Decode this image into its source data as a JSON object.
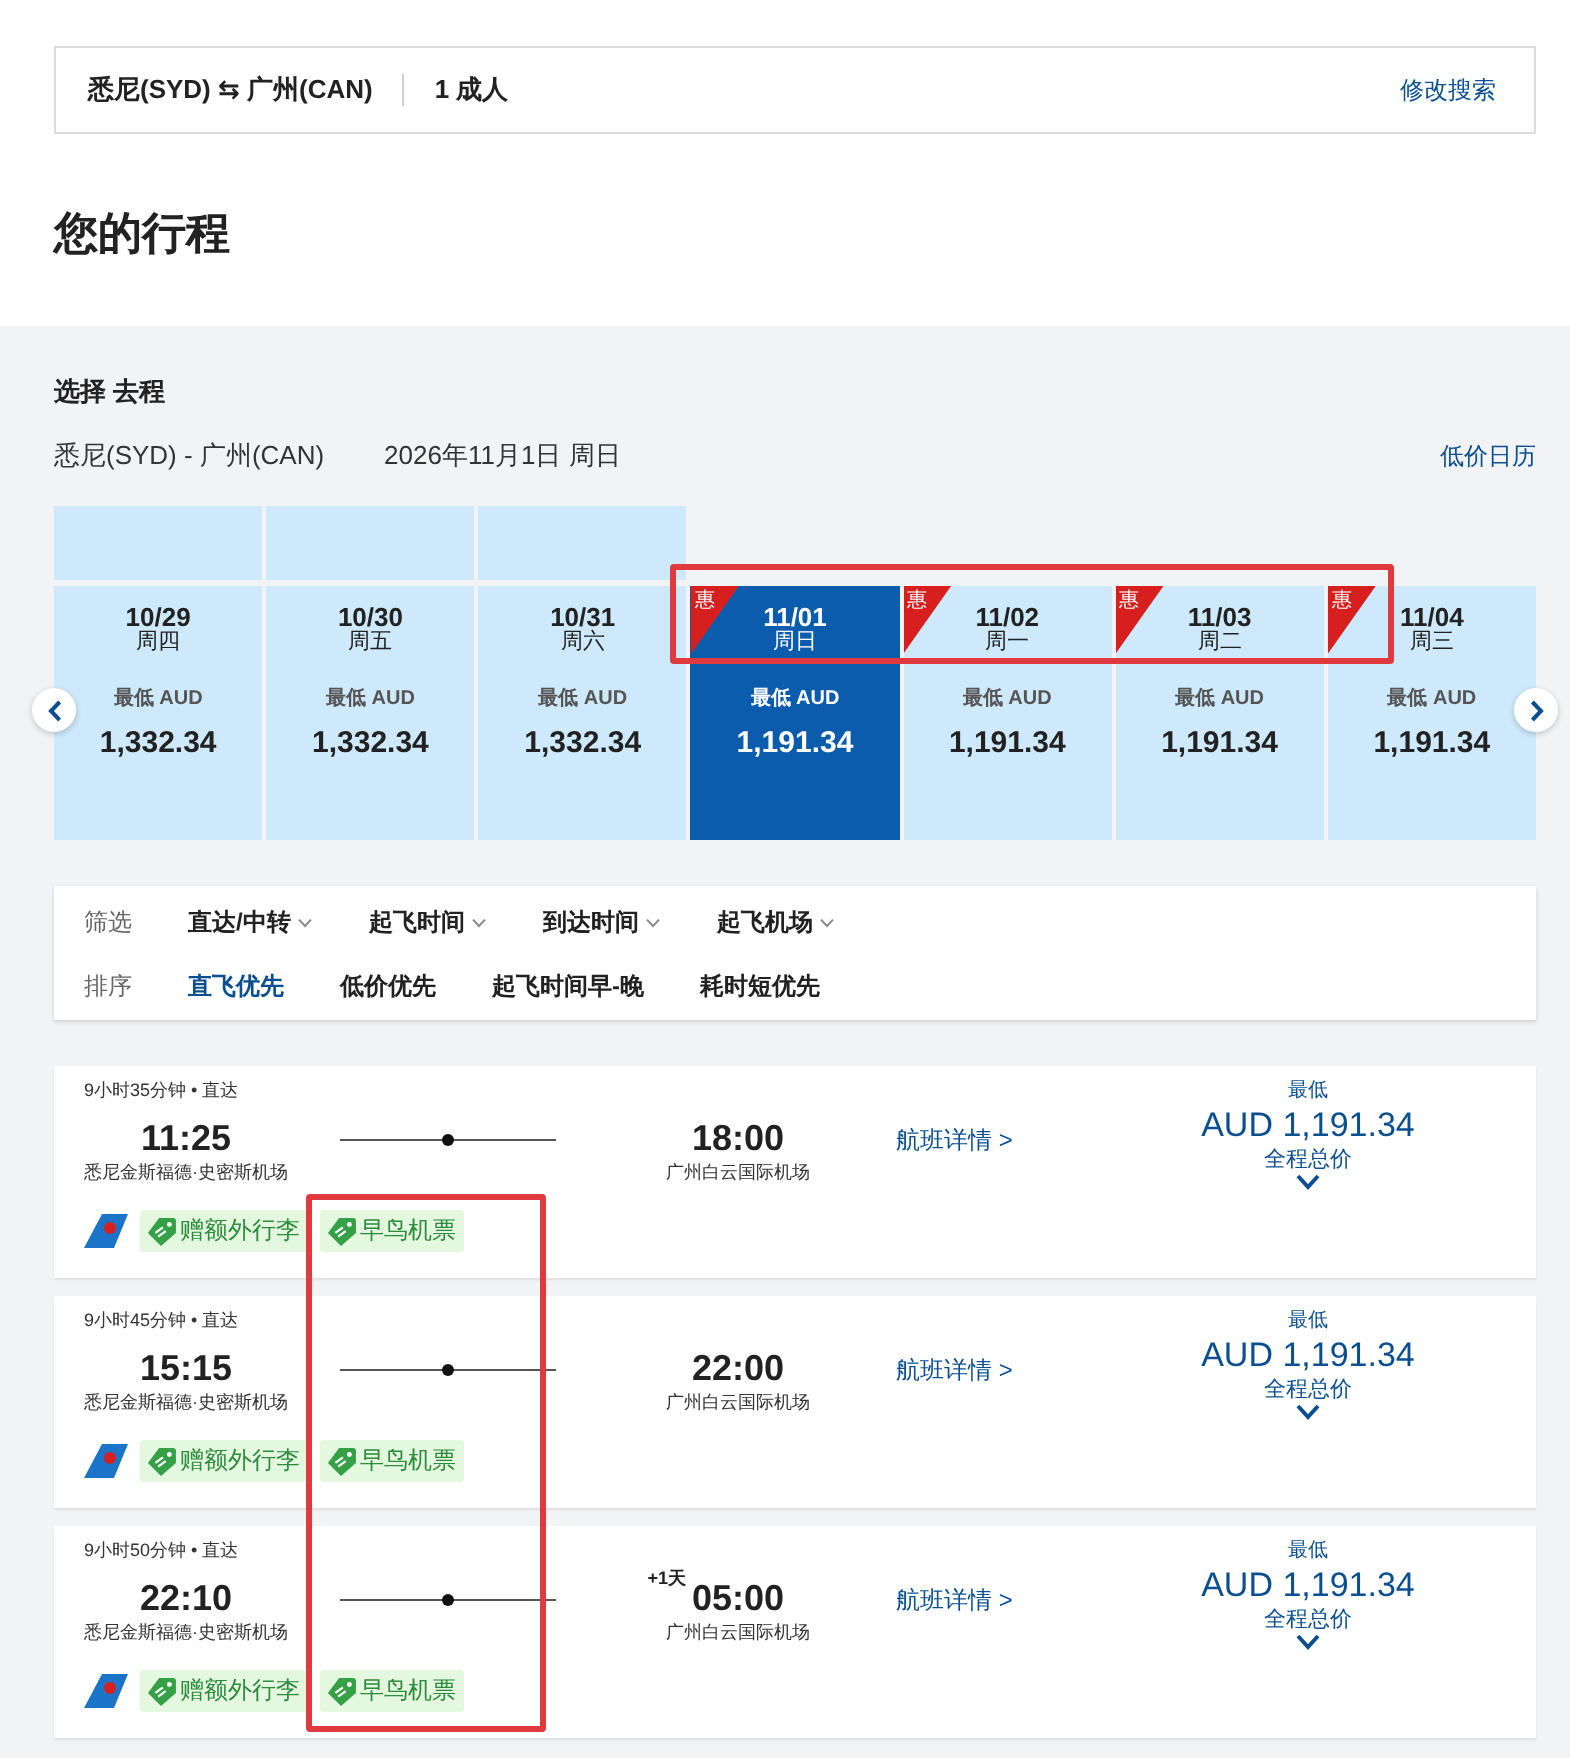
{
  "search_summary": {
    "route": "悉尼(SYD) ⇆ 广州(CAN)",
    "passengers": "1 成人",
    "modify_link": "修改搜索"
  },
  "page_title": "您的行程",
  "section": {
    "title": "选择 去程",
    "route": "悉尼(SYD) - 广州(CAN)",
    "date": "2026年11月1日 周日",
    "calendar_link": "低价日历"
  },
  "date_strip": {
    "highlighted": true,
    "dates": [
      {
        "date": "10/29",
        "weekday": "周四",
        "price_label": "最低 AUD",
        "price": "1,332.34",
        "selected": false,
        "top_block": true
      },
      {
        "date": "10/30",
        "weekday": "周五",
        "price_label": "最低 AUD",
        "price": "1,332.34",
        "selected": false,
        "top_block": true
      },
      {
        "date": "10/31",
        "weekday": "周六",
        "price_label": "最低 AUD",
        "price": "1,332.34",
        "selected": false,
        "top_block": true
      },
      {
        "date": "11/01",
        "weekday": "周日",
        "price_label": "最低 AUD",
        "price": "1,191.34",
        "selected": true,
        "top_block": false,
        "badge": "惠"
      },
      {
        "date": "11/02",
        "weekday": "周一",
        "price_label": "最低 AUD",
        "price": "1,191.34",
        "selected": false,
        "top_block": false,
        "badge": "惠"
      },
      {
        "date": "11/03",
        "weekday": "周二",
        "price_label": "最低 AUD",
        "price": "1,191.34",
        "selected": false,
        "top_block": false,
        "badge": "惠"
      },
      {
        "date": "11/04",
        "weekday": "周三",
        "price_label": "最低 AUD",
        "price": "1,191.34",
        "selected": false,
        "top_block": false,
        "badge": "惠"
      }
    ]
  },
  "filters": {
    "label": "筛选",
    "items": [
      "直达/中转",
      "起飞时间",
      "到达时间",
      "起飞机场"
    ]
  },
  "sort": {
    "label": "排序",
    "options": [
      {
        "label": "直飞优先",
        "selected": true
      },
      {
        "label": "低价优先",
        "selected": false
      },
      {
        "label": "起飞时间早-晚",
        "selected": false
      },
      {
        "label": "耗时短优先",
        "selected": false
      }
    ]
  },
  "flight_list": {
    "highlighted": true,
    "flights": [
      {
        "duration": "9小时35分钟 • 直达",
        "depart_time": "11:25",
        "depart_airport": "悉尼金斯福德·史密斯机场",
        "arrive_time": "18:00",
        "arrive_airport": "广州白云国际机场",
        "details_link": "航班详情 >",
        "price_label": "最低",
        "price": "AUD 1,191.34",
        "price_note": "全程总价",
        "tags": [
          "赠额外行李",
          "早鸟机票"
        ]
      },
      {
        "duration": "9小时45分钟 • 直达",
        "depart_time": "15:15",
        "depart_airport": "悉尼金斯福德·史密斯机场",
        "arrive_time": "22:00",
        "arrive_airport": "广州白云国际机场",
        "details_link": "航班详情 >",
        "price_label": "最低",
        "price": "AUD 1,191.34",
        "price_note": "全程总价",
        "tags": [
          "赠额外行李",
          "早鸟机票"
        ]
      },
      {
        "duration": "9小时50分钟 • 直达",
        "depart_time": "22:10",
        "depart_airport": "悉尼金斯福德·史密斯机场",
        "arrive_time": "05:00",
        "day_offset": "+1天",
        "arrive_airport": "广州白云国际机场",
        "details_link": "航班详情 >",
        "price_label": "最低",
        "price": "AUD 1,191.34",
        "price_note": "全程总价",
        "tags": [
          "赠额外行李",
          "早鸟机票"
        ]
      }
    ]
  }
}
